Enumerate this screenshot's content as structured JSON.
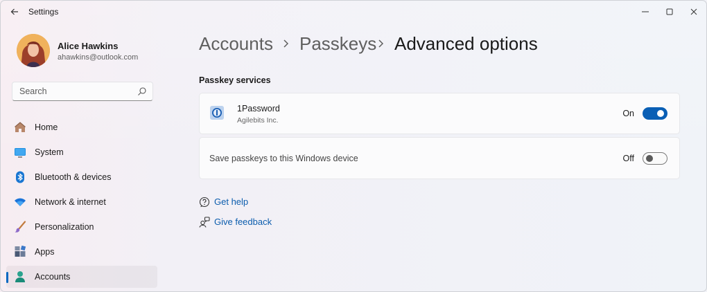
{
  "window": {
    "title": "Settings"
  },
  "profile": {
    "name": "Alice Hawkins",
    "email": "ahawkins@outlook.com"
  },
  "search": {
    "placeholder": "Search"
  },
  "nav": {
    "items": [
      {
        "label": "Home",
        "icon": "home-icon"
      },
      {
        "label": "System",
        "icon": "system-icon"
      },
      {
        "label": "Bluetooth & devices",
        "icon": "bluetooth-icon"
      },
      {
        "label": "Network & internet",
        "icon": "wifi-icon"
      },
      {
        "label": "Personalization",
        "icon": "brush-icon"
      },
      {
        "label": "Apps",
        "icon": "apps-icon"
      },
      {
        "label": "Accounts",
        "icon": "accounts-icon",
        "active": true
      }
    ]
  },
  "breadcrumb": [
    "Accounts",
    "Passkeys",
    "Advanced options"
  ],
  "section": {
    "title": "Passkey services"
  },
  "services": [
    {
      "name": "1Password",
      "vendor": "Agilebits Inc.",
      "state": "On",
      "enabled": true
    },
    {
      "name": "Save passkeys to this Windows device",
      "state": "Off",
      "enabled": false
    }
  ],
  "links": {
    "help": "Get help",
    "feedback": "Give feedback"
  },
  "colors": {
    "accent": "#0a5fb5",
    "link": "#0b5cad"
  }
}
